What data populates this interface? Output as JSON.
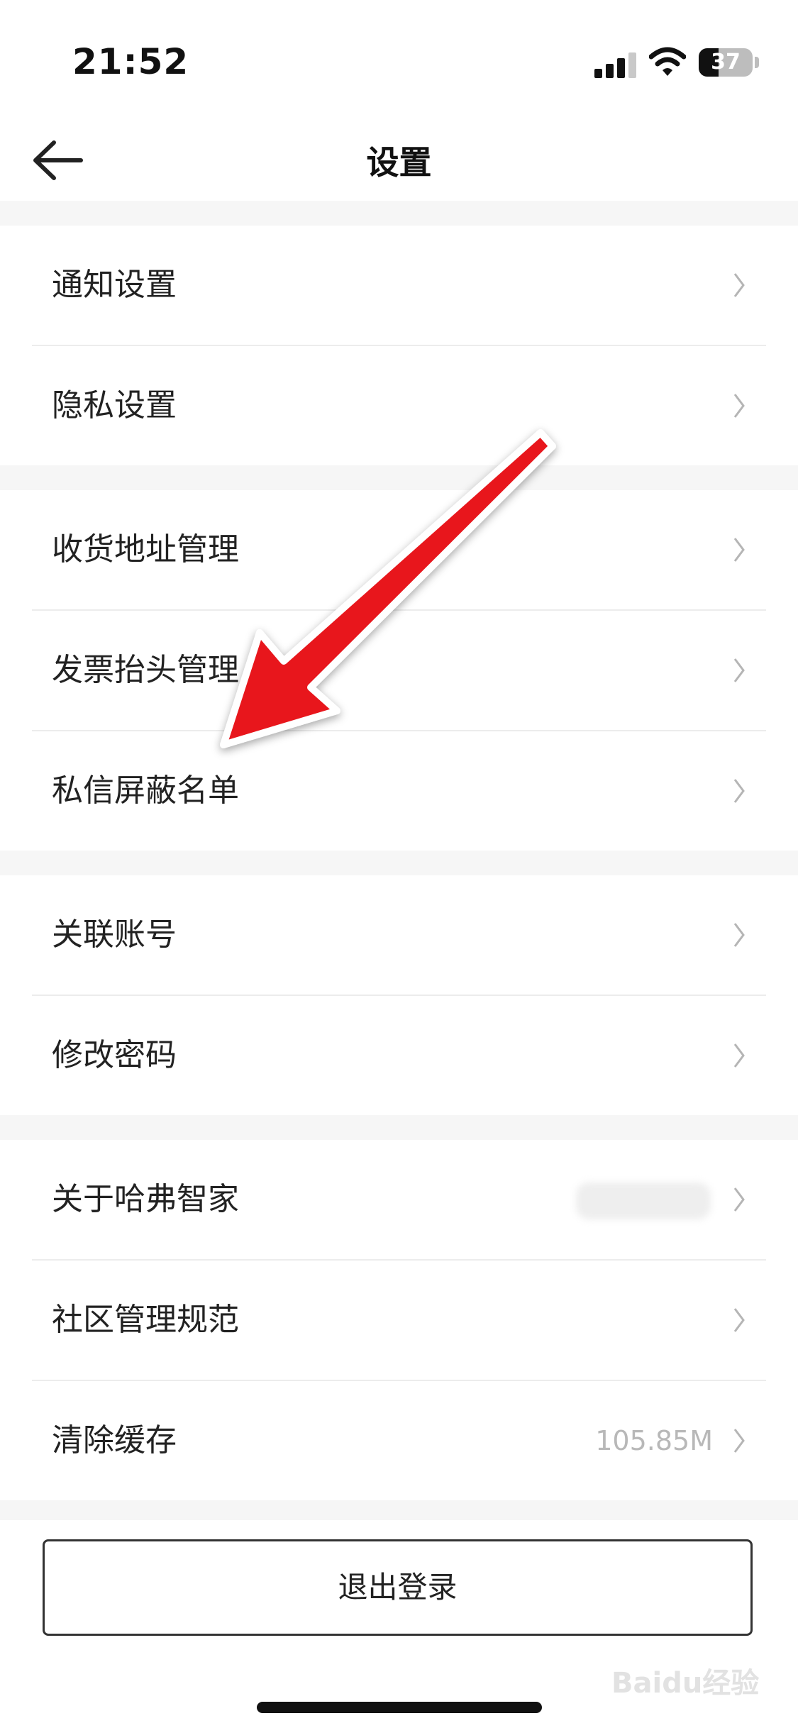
{
  "status": {
    "time": "21:52",
    "battery": "37",
    "battery_level": 0.37
  },
  "header": {
    "title": "设置"
  },
  "groups": [
    {
      "items": [
        {
          "label": "通知设置"
        },
        {
          "label": "隐私设置"
        }
      ]
    },
    {
      "items": [
        {
          "label": "收货地址管理"
        },
        {
          "label": "发票抬头管理"
        },
        {
          "label": "私信屏蔽名单"
        }
      ]
    },
    {
      "items": [
        {
          "label": "关联账号"
        },
        {
          "label": "修改密码"
        }
      ]
    },
    {
      "items": [
        {
          "label": "关于哈弗智家"
        },
        {
          "label": "社区管理规范"
        },
        {
          "label": "清除缓存",
          "value": "105.85M"
        }
      ]
    }
  ],
  "logout": {
    "label": "退出登录"
  },
  "watermark": "Baidu经验",
  "colors": {
    "annotation_arrow": "#e8161b",
    "accent_text": "#222222",
    "secondary_text": "#b8b8b8"
  }
}
